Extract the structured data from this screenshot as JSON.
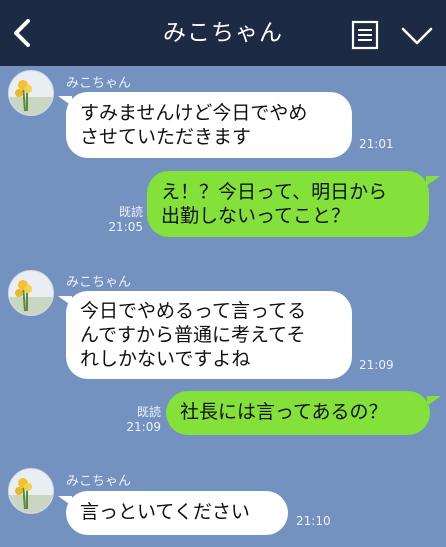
{
  "header": {
    "title": "みこちゃん",
    "back_icon": "chevron-left-icon",
    "memo_icon": "note-list-icon",
    "menu_icon": "chevron-down-icon"
  },
  "messages": [
    {
      "direction": "incoming",
      "sender": "みこちゃん",
      "lines": [
        "すみませんけど今日でやめ",
        "させていただきます"
      ],
      "time": "21:01"
    },
    {
      "direction": "outgoing",
      "read_label": "既読",
      "lines": [
        "え！？今日って、明日から",
        "出勤しないってこと？"
      ],
      "time": "21:05"
    },
    {
      "direction": "incoming",
      "sender": "みこちゃん",
      "lines": [
        "今日でやめるって言ってる",
        "んですから普通に考えてそ",
        "れしかないですよね"
      ],
      "time": "21:09"
    },
    {
      "direction": "outgoing",
      "read_label": "既読",
      "lines": [
        "社長には言ってあるの？"
      ],
      "time": "21:09"
    },
    {
      "direction": "incoming",
      "sender": "みこちゃん",
      "lines": [
        "言っといてください"
      ],
      "time": "21:10"
    }
  ],
  "colors": {
    "background": "#7392c0",
    "header": "#1c2a44",
    "incoming_bubble": "#ffffff",
    "outgoing_bubble": "#84e13a"
  }
}
